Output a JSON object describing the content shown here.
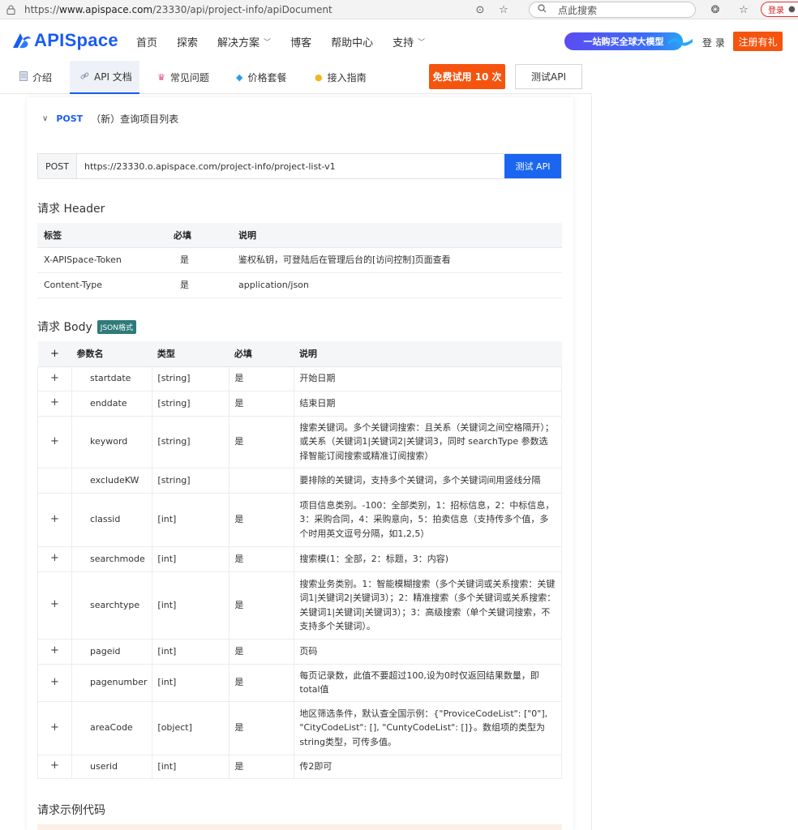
{
  "browser": {
    "url_prefix": "https://",
    "url_domain": "www.apispace.com",
    "url_path": "/23330/api/project-info/apiDocument",
    "search_placeholder": "点此搜索",
    "profile_label": "登录"
  },
  "header": {
    "logo_text": "APISpace",
    "nav": [
      {
        "label": "首页"
      },
      {
        "label": "探索"
      },
      {
        "label": "解决方案",
        "dropdown": true
      },
      {
        "label": "博客"
      },
      {
        "label": "帮助中心"
      },
      {
        "label": "支持",
        "dropdown": true
      }
    ],
    "promo_label": "一站购买全球大模型",
    "login_label": "登 录",
    "register_label": "注册有礼"
  },
  "tabs": {
    "items": [
      {
        "label": "介绍",
        "icon": "document-icon"
      },
      {
        "label": "API 文档",
        "icon": "link-icon"
      },
      {
        "label": "常见问题",
        "icon": "question-icon"
      },
      {
        "label": "价格套餐",
        "icon": "diamond-icon"
      },
      {
        "label": "接入指南",
        "icon": "bulb-icon"
      }
    ],
    "active": "API 文档",
    "trial_label": "免费试用 10 次",
    "test_label": "测试API"
  },
  "endpoint": {
    "method": "POST",
    "name": "（新）查询项目列表",
    "url_method": "POST",
    "url": "https://23330.o.apispace.com/project-info/project-list-v1",
    "test_button": "测试 API"
  },
  "request_header": {
    "title": "请求 Header",
    "columns": [
      "标签",
      "必填",
      "说明"
    ],
    "rows": [
      [
        "X-APISpace-Token",
        "是",
        "鉴权私钥，可登陆后在管理后台的[访问控制]页面查看"
      ],
      [
        "Content-Type",
        "是",
        "application/json"
      ]
    ]
  },
  "request_body": {
    "title": "请求 Body",
    "badge": "JSON格式",
    "expand_header": "+",
    "columns": [
      "参数名",
      "类型",
      "必填",
      "说明"
    ],
    "rows": [
      {
        "expand": "+",
        "name": "startdate",
        "type": "[string]",
        "required": "是",
        "desc": "开始日期"
      },
      {
        "expand": "+",
        "name": "enddate",
        "type": "[string]",
        "required": "是",
        "desc": "结束日期"
      },
      {
        "expand": "+",
        "name": "keyword",
        "type": "[string]",
        "required": "是",
        "desc": "搜索关键词。多个关键词搜索：且关系（关键词之间空格隔开）；或关系（关键词1|关键词2|关键词3，同时 searchType 参数选择智能订阅搜索或精准订阅搜索）"
      },
      {
        "expand": "",
        "name": "excludeKW",
        "type": "[string]",
        "required": "",
        "desc": "要排除的关键词，支持多个关键词，多个关键词间用竖线分隔"
      },
      {
        "expand": "+",
        "name": "classid",
        "type": "[int]",
        "required": "是",
        "desc": "项目信息类别。-100：全部类别，1：招标信息，2：中标信息，3：采购合同，4：采购意向，5：拍卖信息（支持传多个值，多个时用英文逗号分隔，如1,2,5）"
      },
      {
        "expand": "+",
        "name": "searchmode",
        "type": "[int]",
        "required": "是",
        "desc": "搜索模(1：全部，2：标题，3：内容)"
      },
      {
        "expand": "+",
        "name": "searchtype",
        "type": "[int]",
        "required": "是",
        "desc": "搜索业务类别。1：智能模糊搜索（多个关键词或关系搜索：关键词1|关键词2|关键词3）；2：精准搜索（多个关键词或关系搜索：关键词1|关键词|关键词3）；3：高级搜索（单个关键词搜索，不支持多个关键词）。"
      },
      {
        "expand": "+",
        "name": "pageid",
        "type": "[int]",
        "required": "是",
        "desc": "页码"
      },
      {
        "expand": "+",
        "name": "pagenumber",
        "type": "[int]",
        "required": "是",
        "desc": "每页记录数，此值不要超过100,设为0时仅返回结果数量，即total值"
      },
      {
        "expand": "+",
        "name": "areaCode",
        "type": "[object]",
        "required": "是",
        "desc": "地区筛选条件，默认查全国示例：{\"ProviceCodeList\": [\"0\"], \"CityCodeList\": [], \"CuntyCodeList\": []}。数组项的类型为string类型，可传多值。"
      },
      {
        "expand": "+",
        "name": "userid",
        "type": "[int]",
        "required": "是",
        "desc": "传2即可"
      }
    ]
  },
  "example": {
    "title": "请求示例代码"
  },
  "colors": {
    "brand_blue": "#1a5cf0",
    "accent_orange": "#f5540f",
    "badge_teal": "#2e7b7a"
  }
}
